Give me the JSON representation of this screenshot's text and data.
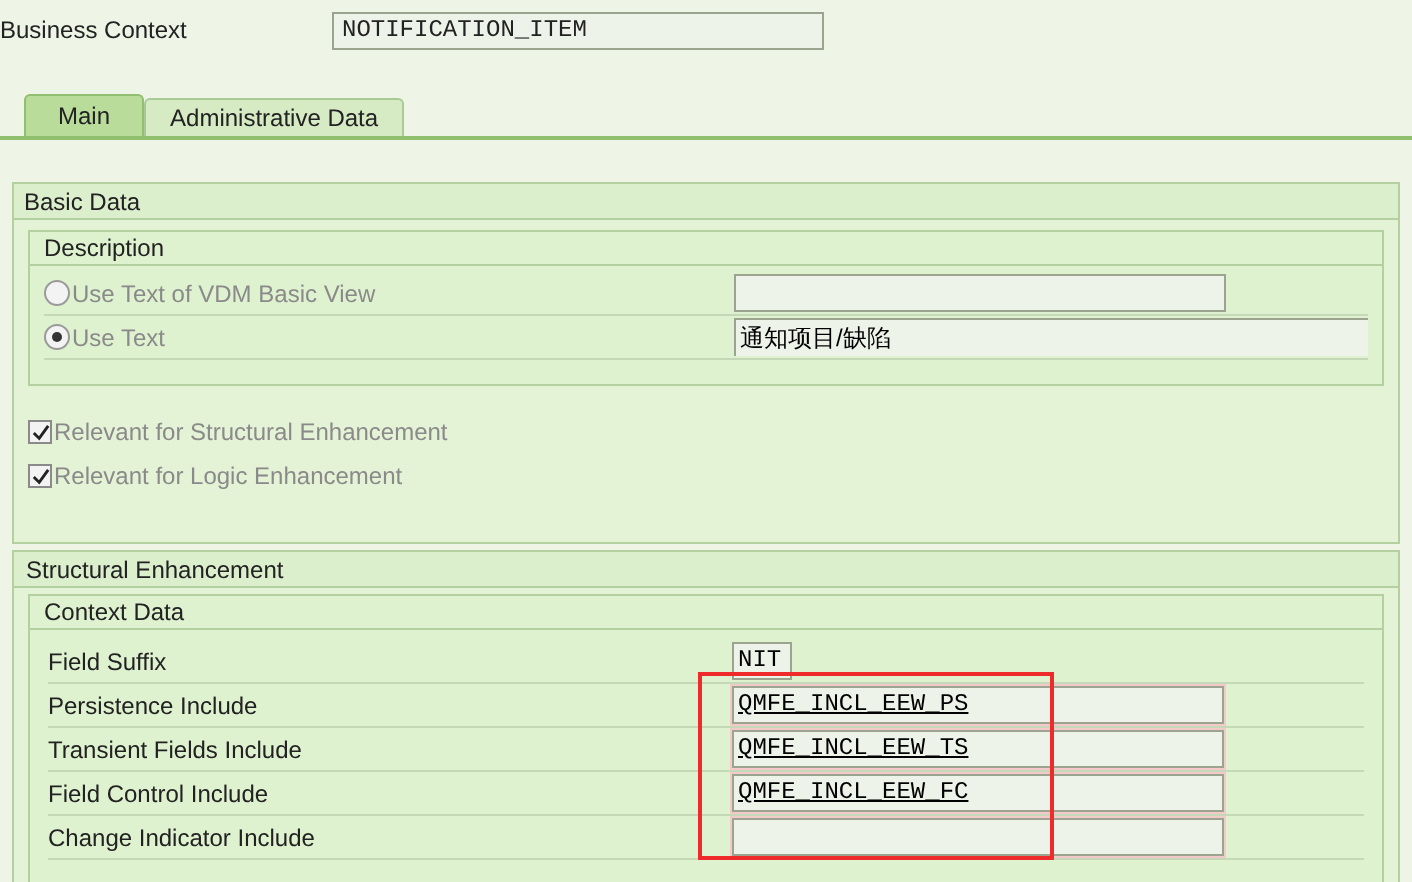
{
  "business_context": {
    "label": "Business Context",
    "value": "NOTIFICATION_ITEM"
  },
  "tabs": [
    {
      "label": "Main",
      "selected": true
    },
    {
      "label": "Administrative Data",
      "selected": false
    }
  ],
  "basic_data": {
    "title": "Basic Data",
    "description": {
      "title": "Description",
      "options": [
        {
          "label": "Use Text of VDM Basic View",
          "selected": false,
          "disabled": true,
          "wide": false
        },
        {
          "label": "Use Text",
          "selected": true,
          "disabled": true,
          "value": "通知项目/缺陷",
          "wide": true
        }
      ]
    },
    "checkboxes": [
      {
        "label": "Relevant for Structural Enhancement",
        "checked": true,
        "disabled": true
      },
      {
        "label": "Relevant for Logic Enhancement",
        "checked": true,
        "disabled": true
      }
    ]
  },
  "structural_enhancement": {
    "title": "Structural Enhancement",
    "context_data": {
      "title": "Context Data",
      "rows": [
        {
          "label": "Field Suffix",
          "value": "NIT",
          "kind": "short",
          "link": false,
          "highlighted": false
        },
        {
          "label": "Persistence Include",
          "value": "QMFE_INCL_EEW_PS",
          "kind": "long",
          "link": true,
          "highlighted": true
        },
        {
          "label": "Transient Fields Include",
          "value": "QMFE_INCL_EEW_TS",
          "kind": "long",
          "link": true,
          "highlighted": true
        },
        {
          "label": "Field Control Include",
          "value": "QMFE_INCL_EEW_FC",
          "kind": "long",
          "link": true,
          "highlighted": true
        },
        {
          "label": "Change Indicator Include",
          "kind": "long",
          "link": false,
          "highlighted": true
        }
      ]
    }
  }
}
